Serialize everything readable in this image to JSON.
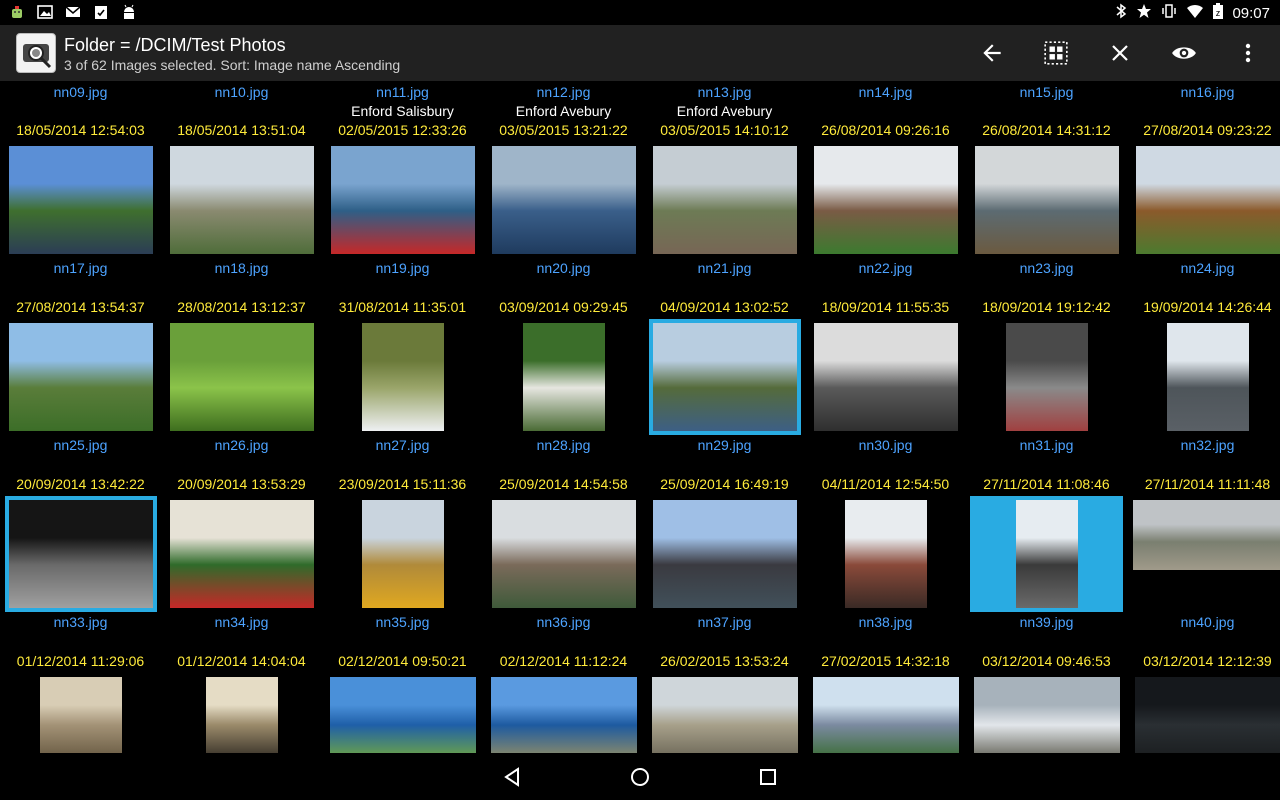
{
  "status_bar": {
    "time": "09:07",
    "left_icons": [
      "android-debug-icon",
      "image-icon",
      "gmail-icon",
      "clipboard-icon",
      "android-icon"
    ],
    "right_icons": [
      "bluetooth-icon",
      "star-icon",
      "vibrate-icon",
      "wifi-icon",
      "battery-icon"
    ]
  },
  "action_bar": {
    "title": "Folder = /DCIM/Test Photos",
    "subtitle": "3 of 62 Images selected.   Sort: Image name Ascending",
    "actions": [
      "back-arrow-icon",
      "select-all-icon",
      "close-icon",
      "eye-icon",
      "overflow-menu-icon"
    ]
  },
  "top_row_filenames": [
    "nn09.jpg",
    "nn10.jpg",
    "nn11.jpg",
    "nn12.jpg",
    "nn13.jpg",
    "nn14.jpg",
    "nn15.jpg",
    "nn16.jpg"
  ],
  "rows": [
    {
      "cells": [
        {
          "caption": "",
          "date": "18/05/2014  12:54:03",
          "name": "nn17.jpg",
          "selected": false
        },
        {
          "caption": "",
          "date": "18/05/2014  13:51:04",
          "name": "nn18.jpg",
          "selected": false
        },
        {
          "caption": "Enford Salisbury",
          "date": "02/05/2015  12:33:26",
          "name": "nn19.jpg",
          "selected": false
        },
        {
          "caption": "Enford Avebury",
          "date": "03/05/2015  13:21:22",
          "name": "nn20.jpg",
          "selected": false
        },
        {
          "caption": "Enford Avebury",
          "date": "03/05/2015  14:10:12",
          "name": "nn21.jpg",
          "selected": false
        },
        {
          "caption": "",
          "date": "26/08/2014  09:26:16",
          "name": "nn22.jpg",
          "selected": false
        },
        {
          "caption": "",
          "date": "26/08/2014  14:31:12",
          "name": "nn23.jpg",
          "selected": false
        },
        {
          "caption": "",
          "date": "27/08/2014  09:23:22",
          "name": "nn24.jpg",
          "selected": false
        }
      ]
    },
    {
      "cells": [
        {
          "caption": "",
          "date": "27/08/2014  13:54:37",
          "name": "nn25.jpg",
          "selected": false
        },
        {
          "caption": "",
          "date": "28/08/2014  13:12:37",
          "name": "nn26.jpg",
          "selected": false
        },
        {
          "caption": "",
          "date": "31/08/2014  11:35:01",
          "name": "nn27.jpg",
          "selected": false
        },
        {
          "caption": "",
          "date": "03/09/2014  09:29:45",
          "name": "nn28.jpg",
          "selected": false
        },
        {
          "caption": "",
          "date": "04/09/2014  13:02:52",
          "name": "nn29.jpg",
          "selected": true
        },
        {
          "caption": "",
          "date": "18/09/2014  11:55:35",
          "name": "nn30.jpg",
          "selected": false
        },
        {
          "caption": "",
          "date": "18/09/2014  19:12:42",
          "name": "nn31.jpg",
          "selected": false
        },
        {
          "caption": "",
          "date": "19/09/2014  14:26:44",
          "name": "nn32.jpg",
          "selected": false
        }
      ]
    },
    {
      "cells": [
        {
          "caption": "",
          "date": "20/09/2014  13:42:22",
          "name": "nn33.jpg",
          "selected": true
        },
        {
          "caption": "",
          "date": "20/09/2014  13:53:29",
          "name": "nn34.jpg",
          "selected": false
        },
        {
          "caption": "",
          "date": "23/09/2014  15:11:36",
          "name": "nn35.jpg",
          "selected": false
        },
        {
          "caption": "",
          "date": "25/09/2014  14:54:58",
          "name": "nn36.jpg",
          "selected": false
        },
        {
          "caption": "",
          "date": "25/09/2014  16:49:19",
          "name": "nn37.jpg",
          "selected": false
        },
        {
          "caption": "",
          "date": "04/11/2014  12:54:50",
          "name": "nn38.jpg",
          "selected": false
        },
        {
          "caption": "",
          "date": "27/11/2014  11:08:46",
          "name": "nn39.jpg",
          "selected": true
        },
        {
          "caption": "",
          "date": "27/11/2014  11:11:48",
          "name": "nn40.jpg",
          "selected": false
        }
      ]
    },
    {
      "cells": [
        {
          "caption": "",
          "date": "01/12/2014  11:29:06",
          "name": "",
          "selected": false
        },
        {
          "caption": "",
          "date": "01/12/2014  14:04:04",
          "name": "",
          "selected": false
        },
        {
          "caption": "",
          "date": "02/12/2014  09:50:21",
          "name": "",
          "selected": false
        },
        {
          "caption": "",
          "date": "02/12/2014  11:12:24",
          "name": "",
          "selected": false
        },
        {
          "caption": "",
          "date": "26/02/2015  13:53:24",
          "name": "",
          "selected": false
        },
        {
          "caption": "",
          "date": "27/02/2015  14:32:18",
          "name": "",
          "selected": false
        },
        {
          "caption": "",
          "date": "03/12/2014  09:46:53",
          "name": "",
          "selected": false
        },
        {
          "caption": "",
          "date": "03/12/2014  12:12:39",
          "name": "",
          "selected": false
        }
      ]
    }
  ],
  "nav_bar": {
    "buttons": [
      "back-triangle-icon",
      "home-circle-icon",
      "recents-square-icon"
    ]
  },
  "colors": {
    "filename": "#4da3ff",
    "date": "#ffeb3b",
    "caption": "#ffffff",
    "selection": "#29abe2",
    "actionbar": "#212121"
  }
}
